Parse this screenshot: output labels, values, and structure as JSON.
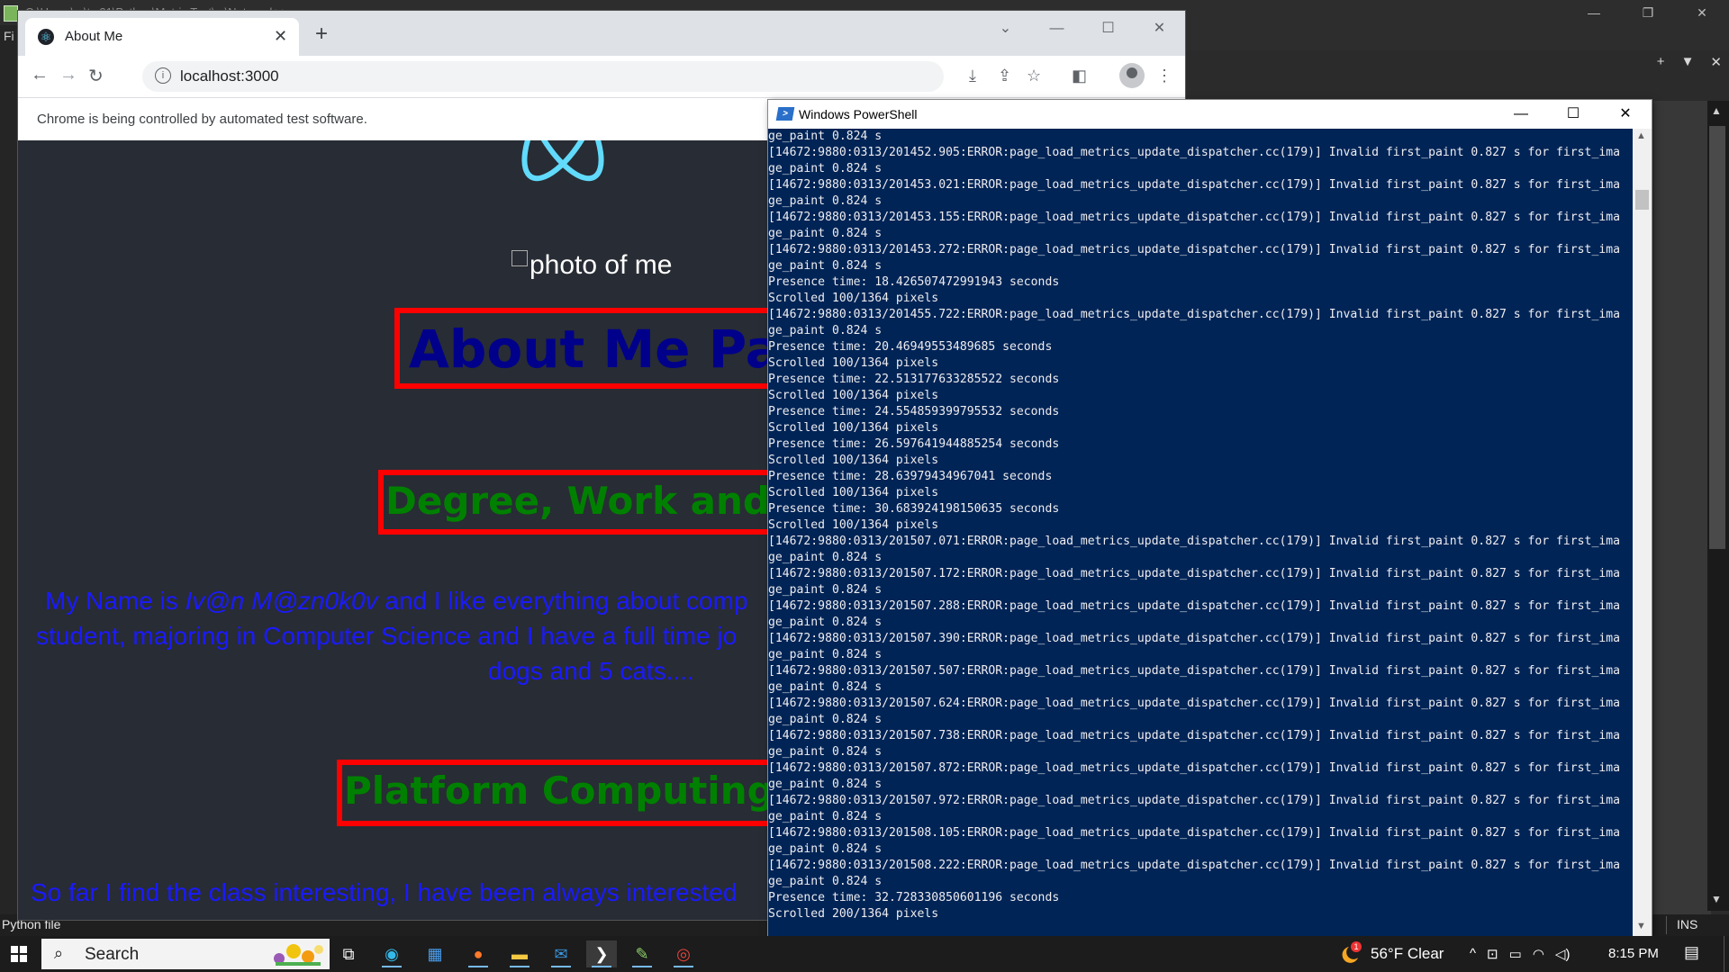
{
  "background_app": {
    "title": "C:\\Users\\...\\ts 21\\Python\\Metric Test\\...\\Notepad++",
    "menu_fragment": "Fi",
    "window_controls": [
      "—",
      "❐",
      "✕"
    ],
    "right_toolbar_icons": [
      "+",
      "▼",
      "✕"
    ],
    "status_left": "Python file",
    "status_right": "INS"
  },
  "chrome": {
    "tab_title": "About Me",
    "tab_close": "✕",
    "new_tab": "+",
    "window_controls": [
      "⌄",
      "—",
      "☐",
      "✕"
    ],
    "nav": {
      "back": "←",
      "forward": "→",
      "reload": "↻"
    },
    "url": "localhost:3000",
    "info_glyph": "i",
    "toolbar_icons": {
      "install": "⤓",
      "share": "⇪",
      "bookmark": "☆",
      "sidepanel": "◧",
      "menu": "⋮"
    },
    "infobar_text": "Chrome is being controlled by automated test software."
  },
  "page": {
    "photo_alt": "photo of me",
    "about_title": "About Me Page",
    "degree_title": "Degree, Work and Li",
    "para1": {
      "line1_start": "My Name is ",
      "line1_name": "Iv@n M@zn0k0v",
      "line1_end": " and I like everything about comp",
      "line2": "student, majoring in Computer Science and I have a full time jo",
      "line3": "dogs and 5 cats...."
    },
    "platform_title": "Platform Computing C",
    "para2_line1": "So far I find the class interesting, I have been always interested"
  },
  "powershell": {
    "title": "Windows PowerShell",
    "window_controls": [
      "—",
      "☐",
      "✕"
    ],
    "scroll_up": "▲",
    "scroll_down": "▼",
    "lines": [
      "ge_paint 0.824 s",
      "[14672:9880:0313/201452.905:ERROR:page_load_metrics_update_dispatcher.cc(179)] Invalid first_paint 0.827 s for first_ima",
      "ge_paint 0.824 s",
      "[14672:9880:0313/201453.021:ERROR:page_load_metrics_update_dispatcher.cc(179)] Invalid first_paint 0.827 s for first_ima",
      "ge_paint 0.824 s",
      "[14672:9880:0313/201453.155:ERROR:page_load_metrics_update_dispatcher.cc(179)] Invalid first_paint 0.827 s for first_ima",
      "ge_paint 0.824 s",
      "[14672:9880:0313/201453.272:ERROR:page_load_metrics_update_dispatcher.cc(179)] Invalid first_paint 0.827 s for first_ima",
      "ge_paint 0.824 s",
      "Presence time: 18.426507472991943 seconds",
      "Scrolled 100/1364 pixels",
      "[14672:9880:0313/201455.722:ERROR:page_load_metrics_update_dispatcher.cc(179)] Invalid first_paint 0.827 s for first_ima",
      "ge_paint 0.824 s",
      "Presence time: 20.46949553489685 seconds",
      "Scrolled 100/1364 pixels",
      "Presence time: 22.513177633285522 seconds",
      "Scrolled 100/1364 pixels",
      "Presence time: 24.554859399795532 seconds",
      "Scrolled 100/1364 pixels",
      "Presence time: 26.597641944885254 seconds",
      "Scrolled 100/1364 pixels",
      "Presence time: 28.63979434967041 seconds",
      "Scrolled 100/1364 pixels",
      "Presence time: 30.683924198150635 seconds",
      "Scrolled 100/1364 pixels",
      "[14672:9880:0313/201507.071:ERROR:page_load_metrics_update_dispatcher.cc(179)] Invalid first_paint 0.827 s for first_ima",
      "ge_paint 0.824 s",
      "[14672:9880:0313/201507.172:ERROR:page_load_metrics_update_dispatcher.cc(179)] Invalid first_paint 0.827 s for first_ima",
      "ge_paint 0.824 s",
      "[14672:9880:0313/201507.288:ERROR:page_load_metrics_update_dispatcher.cc(179)] Invalid first_paint 0.827 s for first_ima",
      "ge_paint 0.824 s",
      "[14672:9880:0313/201507.390:ERROR:page_load_metrics_update_dispatcher.cc(179)] Invalid first_paint 0.827 s for first_ima",
      "ge_paint 0.824 s",
      "[14672:9880:0313/201507.507:ERROR:page_load_metrics_update_dispatcher.cc(179)] Invalid first_paint 0.827 s for first_ima",
      "ge_paint 0.824 s",
      "[14672:9880:0313/201507.624:ERROR:page_load_metrics_update_dispatcher.cc(179)] Invalid first_paint 0.827 s for first_ima",
      "ge_paint 0.824 s",
      "[14672:9880:0313/201507.738:ERROR:page_load_metrics_update_dispatcher.cc(179)] Invalid first_paint 0.827 s for first_ima",
      "ge_paint 0.824 s",
      "[14672:9880:0313/201507.872:ERROR:page_load_metrics_update_dispatcher.cc(179)] Invalid first_paint 0.827 s for first_ima",
      "ge_paint 0.824 s",
      "[14672:9880:0313/201507.972:ERROR:page_load_metrics_update_dispatcher.cc(179)] Invalid first_paint 0.827 s for first_ima",
      "ge_paint 0.824 s",
      "[14672:9880:0313/201508.105:ERROR:page_load_metrics_update_dispatcher.cc(179)] Invalid first_paint 0.827 s for first_ima",
      "ge_paint 0.824 s",
      "[14672:9880:0313/201508.222:ERROR:page_load_metrics_update_dispatcher.cc(179)] Invalid first_paint 0.827 s for first_ima",
      "ge_paint 0.824 s",
      "Presence time: 32.728330850601196 seconds",
      "Scrolled 200/1364 pixels"
    ]
  },
  "taskbar": {
    "search_label": "Search",
    "search_glyph": "⌕",
    "apps": [
      {
        "name": "task-view",
        "glyph": "⧉",
        "color": "#ffffff"
      },
      {
        "name": "edge",
        "glyph": "◉",
        "color": "#35b8e8"
      },
      {
        "name": "store",
        "glyph": "▦",
        "color": "#4aa0f0"
      },
      {
        "name": "firefox",
        "glyph": "●",
        "color": "#ff7a2a"
      },
      {
        "name": "file-explorer",
        "glyph": "▬",
        "color": "#f5c842"
      },
      {
        "name": "mail",
        "glyph": "✉",
        "color": "#3a96dd"
      },
      {
        "name": "powershell",
        "glyph": "❯",
        "color": "#ffffff"
      },
      {
        "name": "notepad-plus-plus",
        "glyph": "✎",
        "color": "#8fd16a"
      },
      {
        "name": "chrome",
        "glyph": "◎",
        "color": "#e8453c"
      }
    ],
    "weather_badge": "1",
    "weather_text": "56°F  Clear",
    "tray_icons": [
      "^",
      "⊡",
      "▭",
      "◠",
      "◁)"
    ],
    "clock": "8:15 PM",
    "notification_glyph": "▤"
  }
}
